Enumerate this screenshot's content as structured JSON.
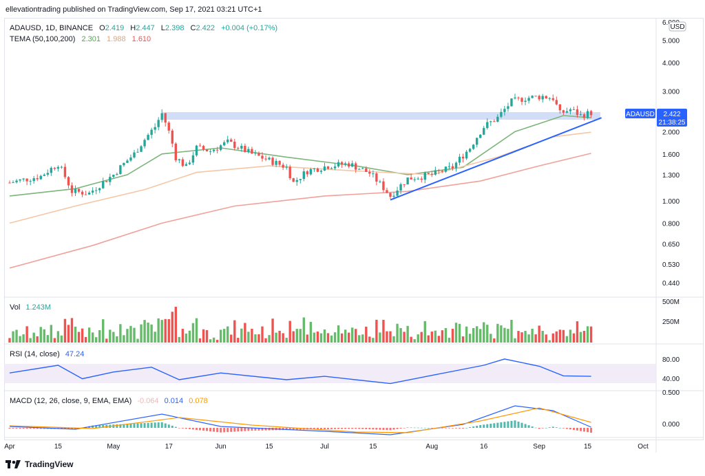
{
  "header": {
    "publisher": "ellevationtrading published on TradingView.com, Sep 17, 2021 03:21 UTC+1"
  },
  "price_legend": {
    "symbol": "ADAUSD, 1D, BINANCE",
    "open_label": "O",
    "open": "2.419",
    "high_label": "H",
    "high": "2.447",
    "low_label": "L",
    "low": "2.398",
    "close_label": "C",
    "close": "2.422",
    "change": "+0.004 (+0.17%)"
  },
  "tema_legend": {
    "label": "TEMA (50,100,200)",
    "v50": "2.301",
    "v100": "1.988",
    "v200": "1.610"
  },
  "currency_button": "USD",
  "symbol_tag": "ADAUSD",
  "price_tag": {
    "price": "2.422",
    "countdown": "21:38:25"
  },
  "vol_legend": {
    "label": "Vol",
    "value": "1.243M"
  },
  "rsi_legend": {
    "label": "RSI (14, close)",
    "value": "47.24"
  },
  "macd_legend": {
    "label": "MACD (12, 26, close, 9, EMA, EMA)",
    "hist": "-0.064",
    "macd": "0.014",
    "signal": "0.078"
  },
  "x_ticks": [
    "Apr",
    "15",
    "May",
    "17",
    "Jun",
    "15",
    "Jul",
    "15",
    "Aug",
    "16",
    "Sep",
    "15",
    "Oct"
  ],
  "y_ticks": [
    "6.000",
    "5.000",
    "4.000",
    "3.000",
    "2.000",
    "1.600",
    "1.300",
    "1.000",
    "0.800",
    "0.650",
    "0.530",
    "0.440"
  ],
  "vol_ticks": [
    "500M",
    "250M"
  ],
  "rsi_ticks": [
    "80.00",
    "40.00"
  ],
  "macd_ticks": [
    "0.500",
    "0.000"
  ],
  "brand": "TradingView",
  "colors": {
    "up": "#26a69a",
    "down": "#ef5350",
    "vol_up": "#66bb6a",
    "vol_down": "#ef5350",
    "tema50": "#7cb57a",
    "tema100": "#f5c6a5",
    "tema200": "#f2a09a",
    "trendline": "#2962ff",
    "zone": "#c3d3f5",
    "rsi": "#2962ff",
    "rsi_band": "#ede7f6",
    "macd": "#2962ff",
    "signal": "#ff9800",
    "tag": "#2962ff"
  },
  "chart_data": {
    "type": "candlestick",
    "title": "ADAUSD, 1D, BINANCE",
    "y_scale": "log",
    "ylim": [
      0.4,
      6.0
    ],
    "x_range": [
      "2021-04-01",
      "2021-10-01"
    ],
    "grid": false,
    "price_path": [
      [
        "2021-04-01",
        1.2
      ],
      [
        "2021-04-10",
        1.28
      ],
      [
        "2021-04-15",
        1.45
      ],
      [
        "2021-04-19",
        1.1
      ],
      [
        "2021-04-24",
        1.08
      ],
      [
        "2021-05-01",
        1.3
      ],
      [
        "2021-05-07",
        1.6
      ],
      [
        "2021-05-13",
        2.1
      ],
      [
        "2021-05-15",
        2.4
      ],
      [
        "2021-05-17",
        2.0
      ],
      [
        "2021-05-19",
        1.55
      ],
      [
        "2021-05-22",
        1.4
      ],
      [
        "2021-05-25",
        1.7
      ],
      [
        "2021-05-29",
        1.65
      ],
      [
        "2021-06-03",
        1.8
      ],
      [
        "2021-06-10",
        1.6
      ],
      [
        "2021-06-15",
        1.5
      ],
      [
        "2021-06-20",
        1.4
      ],
      [
        "2021-06-22",
        1.2
      ],
      [
        "2021-06-26",
        1.35
      ],
      [
        "2021-07-02",
        1.42
      ],
      [
        "2021-07-08",
        1.45
      ],
      [
        "2021-07-14",
        1.32
      ],
      [
        "2021-07-20",
        1.05
      ],
      [
        "2021-07-25",
        1.25
      ],
      [
        "2021-08-01",
        1.3
      ],
      [
        "2021-08-07",
        1.4
      ],
      [
        "2021-08-12",
        1.7
      ],
      [
        "2021-08-16",
        2.1
      ],
      [
        "2021-08-20",
        2.3
      ],
      [
        "2021-08-24",
        2.7
      ],
      [
        "2021-08-28",
        2.8
      ],
      [
        "2021-09-02",
        2.85
      ],
      [
        "2021-09-05",
        2.8
      ],
      [
        "2021-09-07",
        2.4
      ],
      [
        "2021-09-10",
        2.5
      ],
      [
        "2021-09-13",
        2.35
      ],
      [
        "2021-09-16",
        2.42
      ]
    ],
    "tema": [
      {
        "name": "TEMA 50",
        "points": [
          [
            "2021-04-01",
            1.05
          ],
          [
            "2021-04-20",
            1.13
          ],
          [
            "2021-05-05",
            1.3
          ],
          [
            "2021-05-15",
            1.6
          ],
          [
            "2021-06-01",
            1.7
          ],
          [
            "2021-06-20",
            1.55
          ],
          [
            "2021-07-10",
            1.42
          ],
          [
            "2021-07-25",
            1.3
          ],
          [
            "2021-08-10",
            1.4
          ],
          [
            "2021-08-25",
            2.0
          ],
          [
            "2021-09-08",
            2.35
          ],
          [
            "2021-09-16",
            2.3
          ]
        ]
      },
      {
        "name": "TEMA 100",
        "points": [
          [
            "2021-04-01",
            0.8
          ],
          [
            "2021-04-20",
            0.95
          ],
          [
            "2021-05-10",
            1.12
          ],
          [
            "2021-05-25",
            1.33
          ],
          [
            "2021-06-15",
            1.42
          ],
          [
            "2021-07-10",
            1.35
          ],
          [
            "2021-08-01",
            1.3
          ],
          [
            "2021-08-20",
            1.55
          ],
          [
            "2021-09-05",
            1.9
          ],
          [
            "2021-09-16",
            1.99
          ]
        ]
      },
      {
        "name": "TEMA 200",
        "points": [
          [
            "2021-04-01",
            0.51
          ],
          [
            "2021-04-25",
            0.64
          ],
          [
            "2021-05-15",
            0.8
          ],
          [
            "2021-06-05",
            0.95
          ],
          [
            "2021-07-01",
            1.05
          ],
          [
            "2021-07-25",
            1.1
          ],
          [
            "2021-08-15",
            1.22
          ],
          [
            "2021-09-01",
            1.42
          ],
          [
            "2021-09-16",
            1.61
          ]
        ]
      }
    ],
    "resistance_zone": [
      2.3,
      2.45
    ],
    "trendline": [
      [
        "2021-07-20",
        1.01
      ],
      [
        "2021-09-19",
        2.3
      ]
    ],
    "rsi": {
      "ylim": [
        20,
        100
      ],
      "band": [
        30,
        70
      ],
      "points": [
        [
          "2021-04-01",
          54
        ],
        [
          "2021-04-15",
          70
        ],
        [
          "2021-04-22",
          42
        ],
        [
          "2021-05-01",
          56
        ],
        [
          "2021-05-12",
          66
        ],
        [
          "2021-05-20",
          40
        ],
        [
          "2021-06-01",
          54
        ],
        [
          "2021-06-20",
          40
        ],
        [
          "2021-07-01",
          47
        ],
        [
          "2021-07-20",
          32
        ],
        [
          "2021-08-01",
          49
        ],
        [
          "2021-08-16",
          70
        ],
        [
          "2021-08-22",
          83
        ],
        [
          "2021-09-01",
          68
        ],
        [
          "2021-09-08",
          48
        ],
        [
          "2021-09-16",
          47
        ]
      ]
    },
    "macd": {
      "ylim": [
        -0.12,
        0.5
      ],
      "macd_line": [
        [
          "2021-04-01",
          0.02
        ],
        [
          "2021-04-20",
          -0.02
        ],
        [
          "2021-05-15",
          0.2
        ],
        [
          "2021-06-01",
          0.02
        ],
        [
          "2021-07-01",
          -0.05
        ],
        [
          "2021-07-20",
          -0.1
        ],
        [
          "2021-08-10",
          0.05
        ],
        [
          "2021-08-25",
          0.32
        ],
        [
          "2021-09-05",
          0.25
        ],
        [
          "2021-09-16",
          0.01
        ]
      ],
      "signal_line": [
        [
          "2021-04-01",
          0.03
        ],
        [
          "2021-04-25",
          -0.01
        ],
        [
          "2021-05-20",
          0.15
        ],
        [
          "2021-06-10",
          0.04
        ],
        [
          "2021-07-10",
          -0.06
        ],
        [
          "2021-07-25",
          -0.07
        ],
        [
          "2021-08-15",
          0.1
        ],
        [
          "2021-09-01",
          0.29
        ],
        [
          "2021-09-16",
          0.08
        ]
      ]
    }
  }
}
